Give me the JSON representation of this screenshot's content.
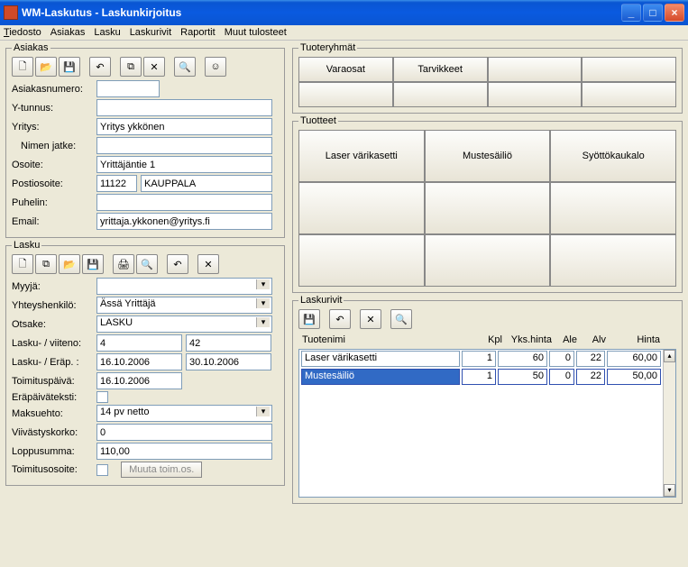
{
  "window": {
    "title": "WM-Laskutus - Laskunkirjoitus"
  },
  "menu": [
    "Tiedosto",
    "Asiakas",
    "Lasku",
    "Laskurivit",
    "Raportit",
    "Muut tulosteet"
  ],
  "asiakas": {
    "legend": "Asiakas",
    "labels": {
      "asiakasnumero": "Asiakasnumero:",
      "ytunnus": "Y-tunnus:",
      "yritys": "Yritys:",
      "nimenjatke": "Nimen jatke:",
      "osoite": "Osoite:",
      "postiosoite": "Postiosoite:",
      "puhelin": "Puhelin:",
      "email": "Email:"
    },
    "values": {
      "asiakasnumero": "",
      "ytunnus": "",
      "yritys": "Yritys ykkönen",
      "nimenjatke": "",
      "osoite": "Yrittäjäntie 1",
      "postinum": "11122",
      "kaupunki": "KAUPPALA",
      "puhelin": "",
      "email": "yrittaja.ykkonen@yritys.fi"
    }
  },
  "lasku": {
    "legend": "Lasku",
    "labels": {
      "myyja": "Myyjä:",
      "yhteys": "Yhteyshenkilö:",
      "otsake": "Otsake:",
      "laskuviiteno": "Lasku- / viiteno:",
      "laskuerap": "Lasku- / Eräp. :",
      "toimituspaiva": "Toimituspäivä:",
      "erapaivatext": "Eräpäiväteksti:",
      "maksuehto": "Maksuehto:",
      "viivastyskorko": "Viivästyskorko:",
      "loppusumma": "Loppusumma:",
      "toimitusosoite": "Toimitusosoite:",
      "muuta": "Muuta toim.os."
    },
    "values": {
      "myyja": "",
      "yhteys": "Ässä Yrittäjä",
      "otsake": "LASKU",
      "laskuno": "4",
      "viiteno": "42",
      "laskupvm": "16.10.2006",
      "erapvm": "30.10.2006",
      "toimituspvm": "16.10.2006",
      "maksuehto": "14 pv netto",
      "viivastyskorko": "0",
      "loppusumma": "110,00"
    }
  },
  "tuoteryhmat": {
    "legend": "Tuoteryhmät",
    "items": [
      "Varaosat",
      "Tarvikkeet",
      "",
      "",
      "",
      "",
      "",
      ""
    ]
  },
  "tuotteet": {
    "legend": "Tuotteet",
    "items": [
      "Laser värikasetti",
      "Mustesäiliö",
      "Syöttökaukalo",
      "",
      "",
      "",
      "",
      "",
      ""
    ]
  },
  "laskurivit": {
    "legend": "Laskurivit",
    "headers": [
      "Tuotenimi",
      "Kpl",
      "Yks.hinta",
      "Ale",
      "Alv",
      "Hinta"
    ],
    "rows": [
      {
        "name": "Laser värikasetti",
        "kpl": "1",
        "yks": "60",
        "ale": "0",
        "alv": "22",
        "hinta": "60,00",
        "sel": false
      },
      {
        "name": "Mustesäiliö",
        "kpl": "1",
        "yks": "50",
        "ale": "0",
        "alv": "22",
        "hinta": "50,00",
        "sel": true
      }
    ]
  }
}
